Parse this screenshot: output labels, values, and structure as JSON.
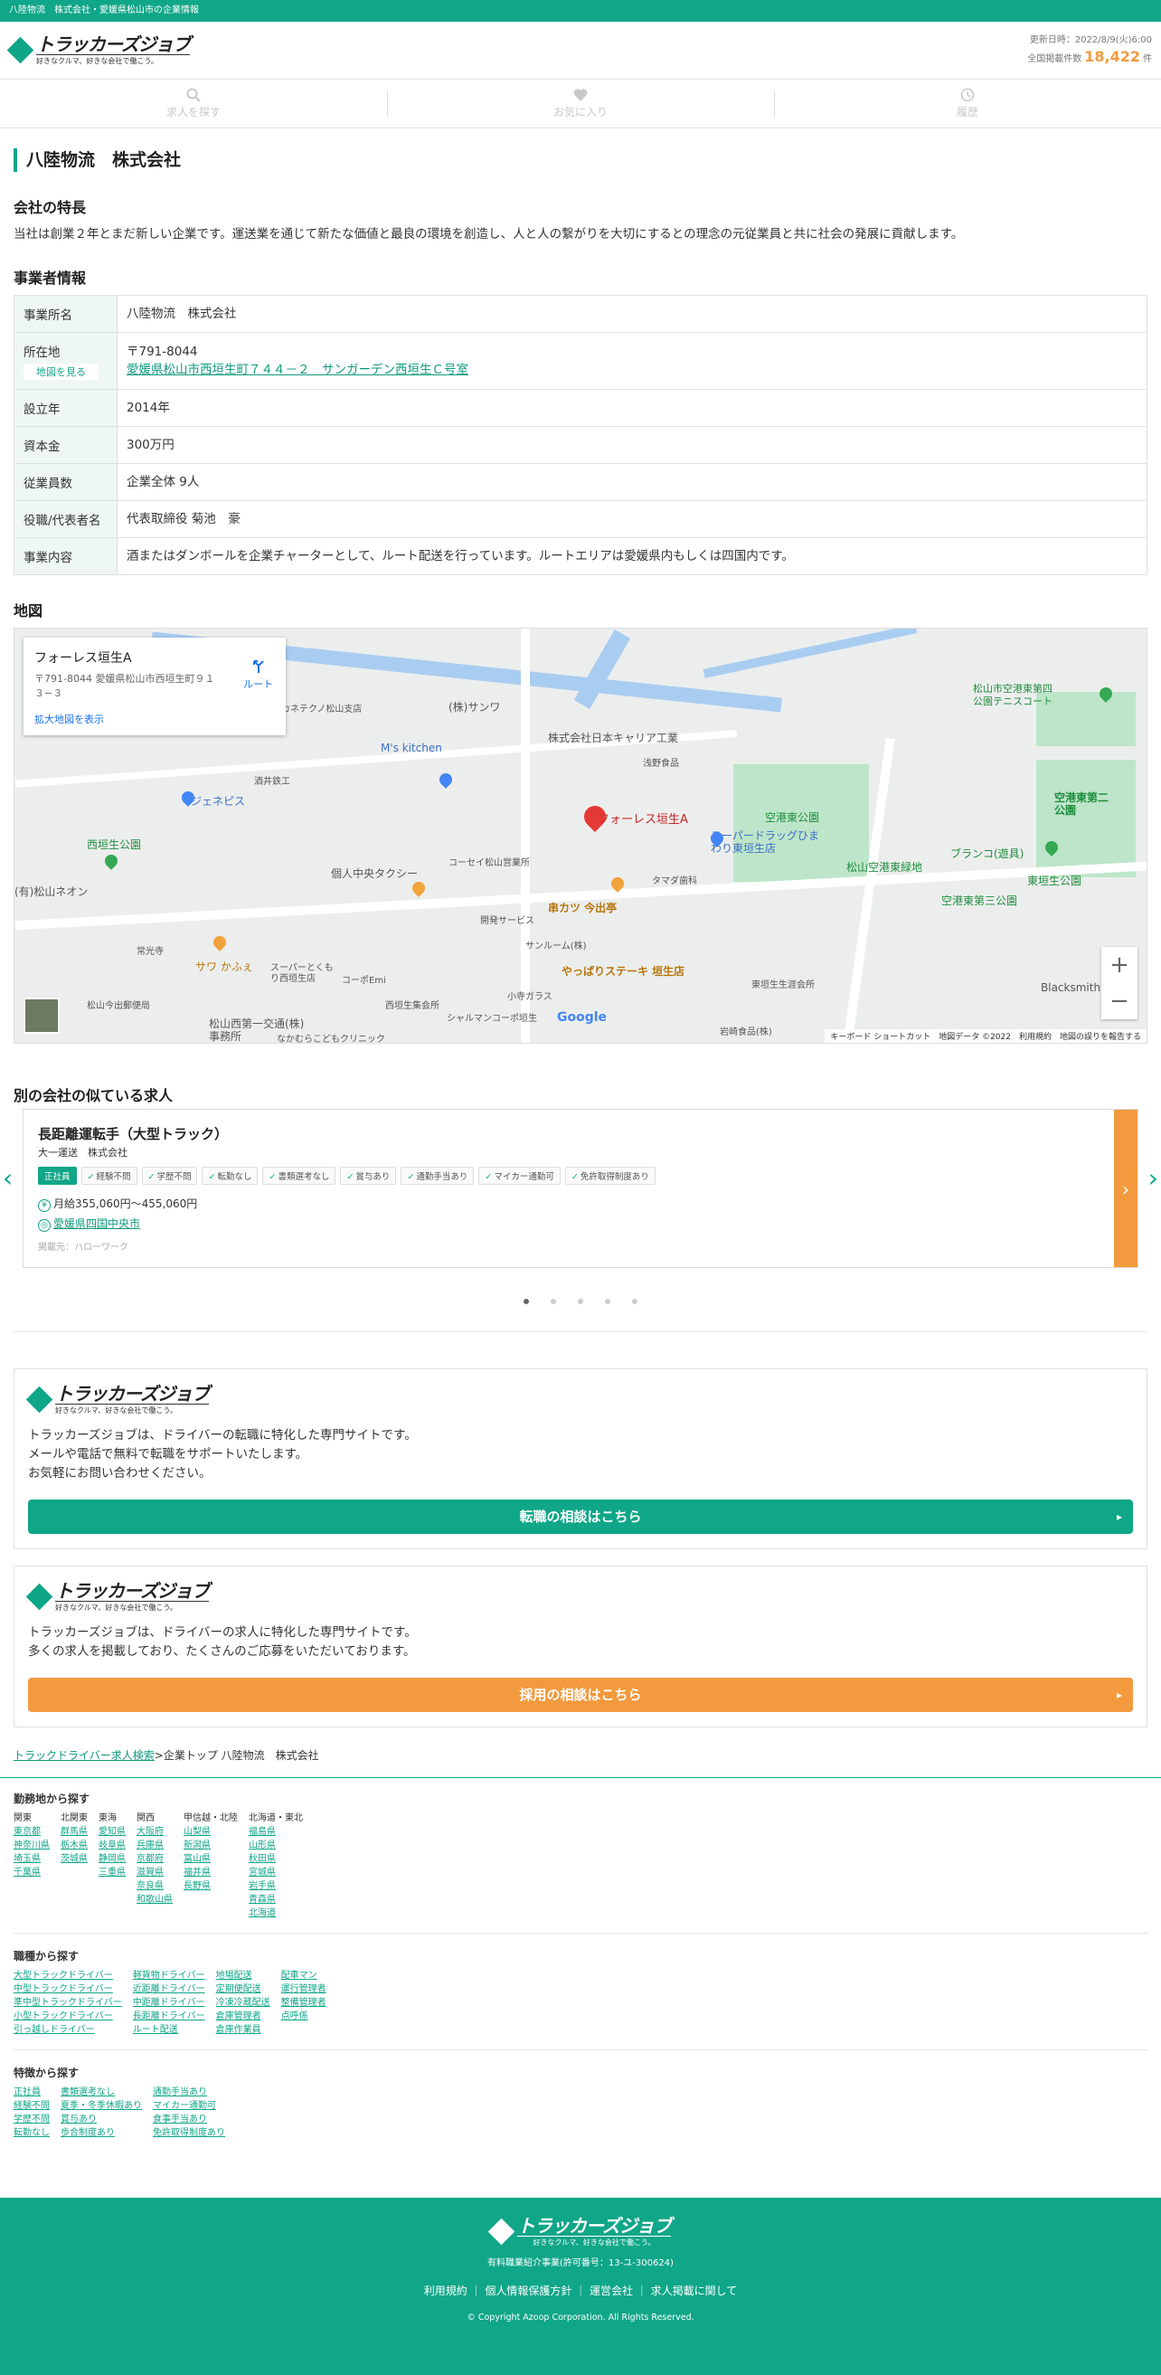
{
  "topbar": "八陸物流　株式会社・愛媛県松山市の企業情報",
  "header": {
    "logo": "トラッカーズジョブ",
    "logo_sub": "好きなクルマ、好きな会社で働こう。",
    "updated": "更新日時：2022/8/9(火)6:00",
    "total_label": "全国掲載件数",
    "total_count": "18,422",
    "total_unit": "件"
  },
  "nav": [
    "求人を探す",
    "お気に入り",
    "履歴"
  ],
  "company": {
    "name": "八陸物流　株式会社",
    "feature_heading": "会社の特長",
    "feature_text": "当社は創業２年とまだ新しい企業です。運送業を通じて新たな価値と最良の環境を創造し、人と人の繋がりを大切にするとの理念の元従業員と共に社会の発展に貢献します。",
    "info_heading": "事業者情報",
    "rows": [
      {
        "label": "事業所名",
        "value": "八陸物流　株式会社"
      },
      {
        "label": "設立年",
        "value": "2014年"
      },
      {
        "label": "資本金",
        "value": "300万円"
      },
      {
        "label": "従業員数",
        "value": "企業全体 9人"
      },
      {
        "label": "役職/代表者名",
        "value": "代表取締役 菊池　豪"
      },
      {
        "label": "事業内容",
        "value": "酒またはダンボールを企業チャーターとして、ルート配送を行っています。ルートエリアは愛媛県内もしくは四国内です。"
      }
    ],
    "address_label": "所在地",
    "map_button": "地図を見る",
    "zip": "〒791-8044",
    "address": "愛媛県松山市西垣生町７４４－２　サンガーデン西垣生Ｃ号室"
  },
  "map": {
    "heading": "地図",
    "place_name": "フォーレス垣生A",
    "place_address": "〒791-8044 愛媛県松山市西垣生町９１３−３",
    "route": "ルート",
    "enlarge": "拡大地図を表示",
    "labels": [
      "(株)サンワ",
      "株式会社日本キャリア工業",
      "浅野食品",
      "空港東公園",
      "スーパードラッグひまわり東垣生店",
      "松山空港東緑地",
      "ブランコ(遊具)",
      "東垣生公園",
      "空港東第三公園",
      "空港東第二公園",
      "松山市空港東第四公園テニスコート",
      "ジェネピス",
      "西垣生公園",
      "コーセイ松山営業所",
      "個人中央タクシー",
      "タマダ歯科",
      "串カツ 今出亭",
      "開発サービス",
      "サンルーム(株)",
      "やっぱりステーキ 垣生店",
      "東垣生生涯会所",
      "サワ かふぇ",
      "常光寺",
      "スーパーとくもり西垣生店",
      "コーポEmi",
      "西垣生集会所",
      "シャルマンコーポ垣生",
      "小寺ガラス",
      "松山今出郵便局",
      "松山西第一交通(株)事務所",
      "なかむらこどもクリニック",
      "岩崎食品(株)",
      "酒井鉄工",
      "M's kitchen",
      "カネテクノ松山支店",
      "Blacksmith",
      "(有)松山ネオン"
    ],
    "pin_label": "フォーレス垣生A",
    "footer": "キーボード ショートカット　地図データ ©2022　利用規約　地図の誤りを報告する",
    "google": "Google"
  },
  "similar": {
    "heading": "別の会社の似ている求人",
    "title": "長距離運転手（大型トラック）",
    "company": "大一運送　株式会社",
    "tags": [
      "正社員",
      "経験不問",
      "学歴不問",
      "転勤なし",
      "書類選考なし",
      "賞与あり",
      "通勤手当あり",
      "マイカー通勤可",
      "免許取得制度あり"
    ],
    "salary": "月給355,060円〜455,060円",
    "location": "愛媛県四国中央市",
    "source": "掲載元：ハローワーク",
    "salary_icon": "¥",
    "loc_icon": "◎"
  },
  "promo1": {
    "text1": "トラッカーズジョブは、ドライバーの転職に特化した専門サイトです。",
    "text2": "メールや電話で無料で転職をサポートいたします。",
    "text3": "お気軽にお問い合わせください。",
    "button": "転職の相談はこちら"
  },
  "promo2": {
    "text1": "トラッカーズジョブは、ドライバーの求人に特化した専門サイトです。",
    "text2": "多くの求人を掲載しており、たくさんのご応募をいただいております。",
    "button": "採用の相談はこちら"
  },
  "breadcrumb": {
    "home": "トラックドライバー求人検索",
    "sep": ">",
    "current": "企業トップ 八陸物流　株式会社"
  },
  "area": {
    "heading": "勤務地から探す",
    "cols": [
      {
        "h": "関東",
        "items": [
          "東京都",
          "神奈川県",
          "埼玉県",
          "千葉県"
        ]
      },
      {
        "h": "北関東",
        "items": [
          "群馬県",
          "栃木県",
          "茨城県"
        ]
      },
      {
        "h": "東海",
        "items": [
          "愛知県",
          "岐阜県",
          "静岡県",
          "三重県"
        ]
      },
      {
        "h": "関西",
        "items": [
          "大阪府",
          "兵庫県",
          "京都府",
          "滋賀県",
          "奈良県",
          "和歌山県"
        ]
      },
      {
        "h": "甲信越・北陸",
        "items": [
          "山梨県",
          "新潟県",
          "富山県",
          "福井県",
          "長野県"
        ]
      },
      {
        "h": "北海道・東北",
        "items": [
          "福島県",
          "山形県",
          "秋田県",
          "宮城県",
          "岩手県",
          "青森県",
          "北海道"
        ]
      }
    ]
  },
  "job": {
    "heading": "職種から探す",
    "cols": [
      [
        "大型トラックドライバー",
        "中型トラックドライバー",
        "準中型トラックドライバー",
        "小型トラックドライバー",
        "引っ越しドライバー"
      ],
      [
        "軽貨物ドライバー",
        "近距離ドライバー",
        "中距離ドライバー",
        "長距離ドライバー",
        "ルート配送"
      ],
      [
        "地場配送",
        "定期便配送",
        "冷凍冷蔵配送",
        "倉庫管理者",
        "倉庫作業員"
      ],
      [
        "配車マン",
        "運行管理者",
        "整備管理者",
        "点呼係"
      ]
    ]
  },
  "feature": {
    "heading": "特徴から探す",
    "cols": [
      [
        "正社員",
        "経験不問",
        "学歴不問",
        "転勤なし"
      ],
      [
        "書類選考なし",
        "夏季・冬季休暇あり",
        "賞与あり",
        "歩合制度あり"
      ],
      [
        "通勤手当あり",
        "マイカー通勤可",
        "食事手当あり",
        "免許取得制度あり"
      ]
    ]
  },
  "footer": {
    "logo": "トラッカーズジョブ",
    "logo_sub": "好きなクルマ、好きな会社で働こう。",
    "license": "有料職業紹介事業(許可番号：13-ユ-300624)",
    "links": [
      "利用規約",
      "個人情報保護方針",
      "運営会社",
      "求人掲載に関して"
    ],
    "copy": "© Copyright Azoop Corporation. All Rights Reserved."
  },
  "colors": {
    "brand": "#10a688",
    "accent": "#f29a3d"
  }
}
